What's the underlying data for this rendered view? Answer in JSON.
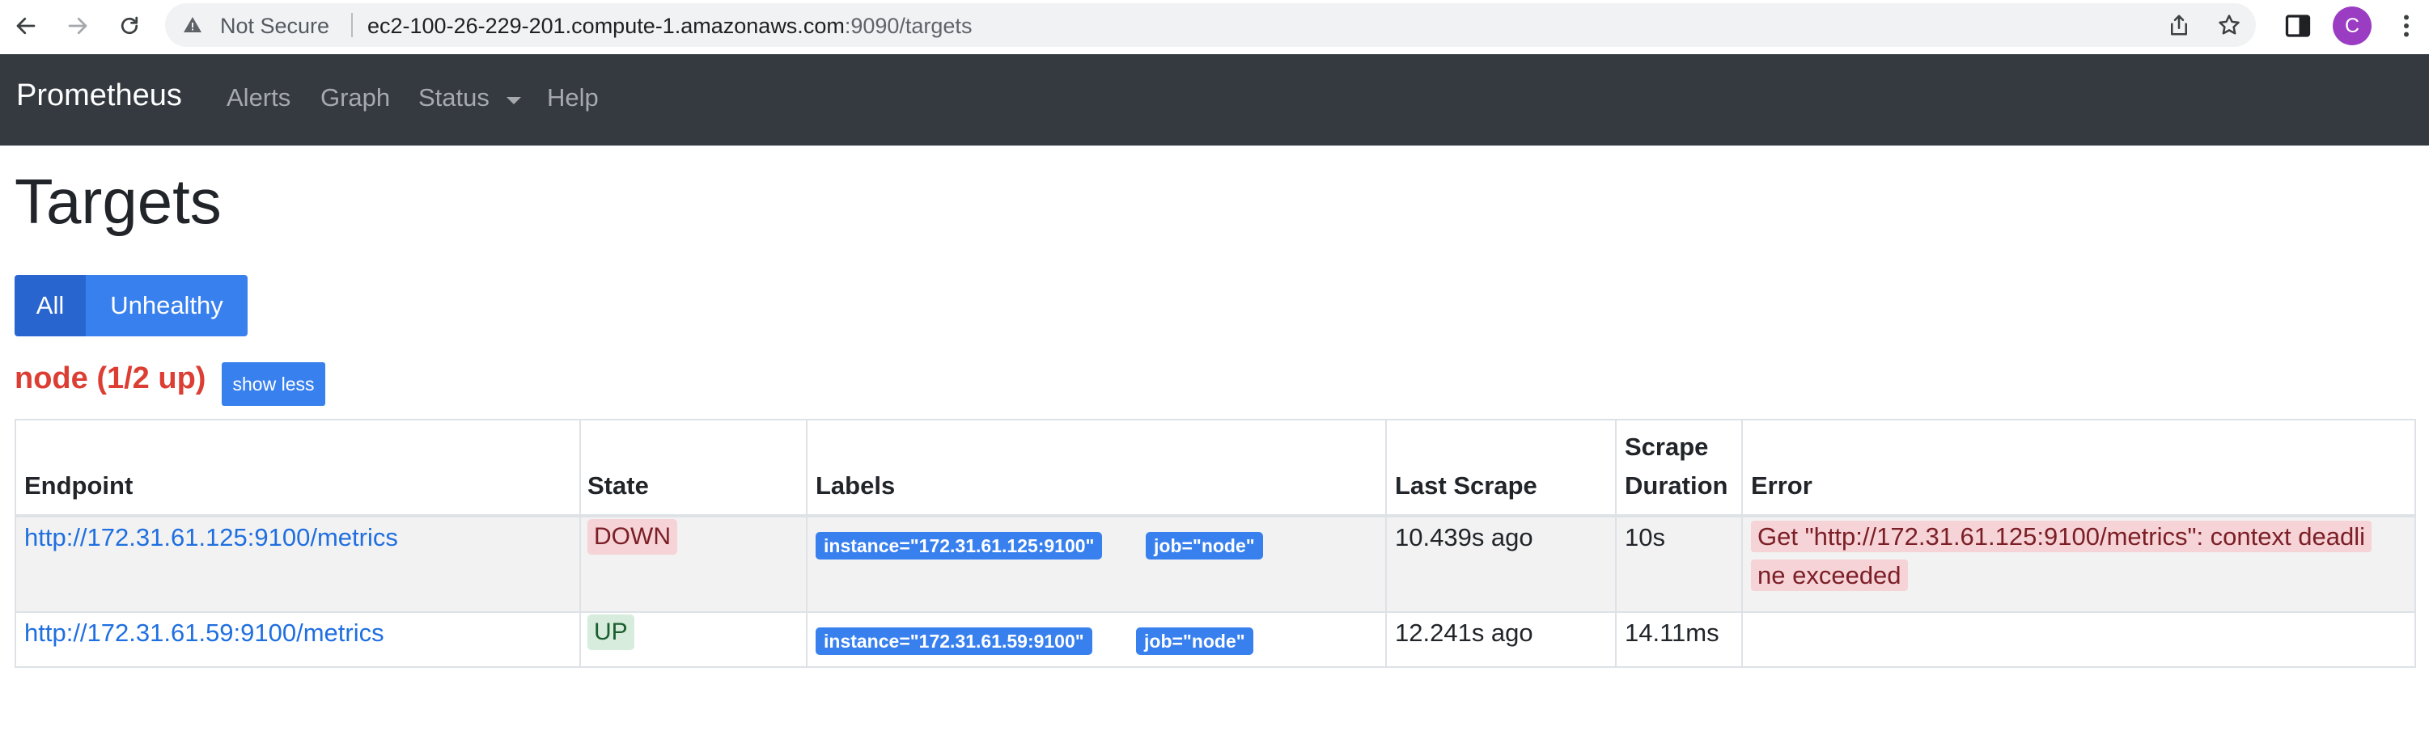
{
  "browser": {
    "security_label": "Not Secure",
    "url_host": "ec2-100-26-229-201.compute-1.amazonaws.com",
    "url_rest": ":9090/targets",
    "avatar_initial": "C"
  },
  "navbar": {
    "brand": "Prometheus",
    "links": [
      "Alerts",
      "Graph",
      "Status",
      "Help"
    ]
  },
  "page": {
    "title": "Targets",
    "filters": [
      "All",
      "Unhealthy"
    ],
    "job_title": "node (1/2 up)",
    "show_less": "show less"
  },
  "table": {
    "headers": {
      "endpoint": "Endpoint",
      "state": "State",
      "labels": "Labels",
      "last_scrape": "Last Scrape",
      "scrape_duration_1": "Scrape",
      "scrape_duration_2": "Duration",
      "error": "Error"
    },
    "rows": [
      {
        "endpoint": "http://172.31.61.125:9100/metrics",
        "state": "DOWN",
        "labels": [
          "instance=\"172.31.61.125:9100\"",
          "job=\"node\""
        ],
        "last_scrape": "10.439s ago",
        "scrape_duration": "10s",
        "error_line1": "Get \"http://172.31.61.125:9100/metrics\": context deadli",
        "error_line2": "ne exceeded"
      },
      {
        "endpoint": "http://172.31.61.59:9100/metrics",
        "state": "UP",
        "labels": [
          "instance=\"172.31.61.59:9100\"",
          "job=\"node\""
        ],
        "last_scrape": "12.241s ago",
        "scrape_duration": "14.11ms",
        "error_line1": "",
        "error_line2": ""
      }
    ]
  },
  "colors": {
    "navbar_bg": "#343a40",
    "primary": "#3880ee",
    "primary_active": "#2865ce",
    "danger": "#dc3e34",
    "link": "#1f6fe0"
  }
}
